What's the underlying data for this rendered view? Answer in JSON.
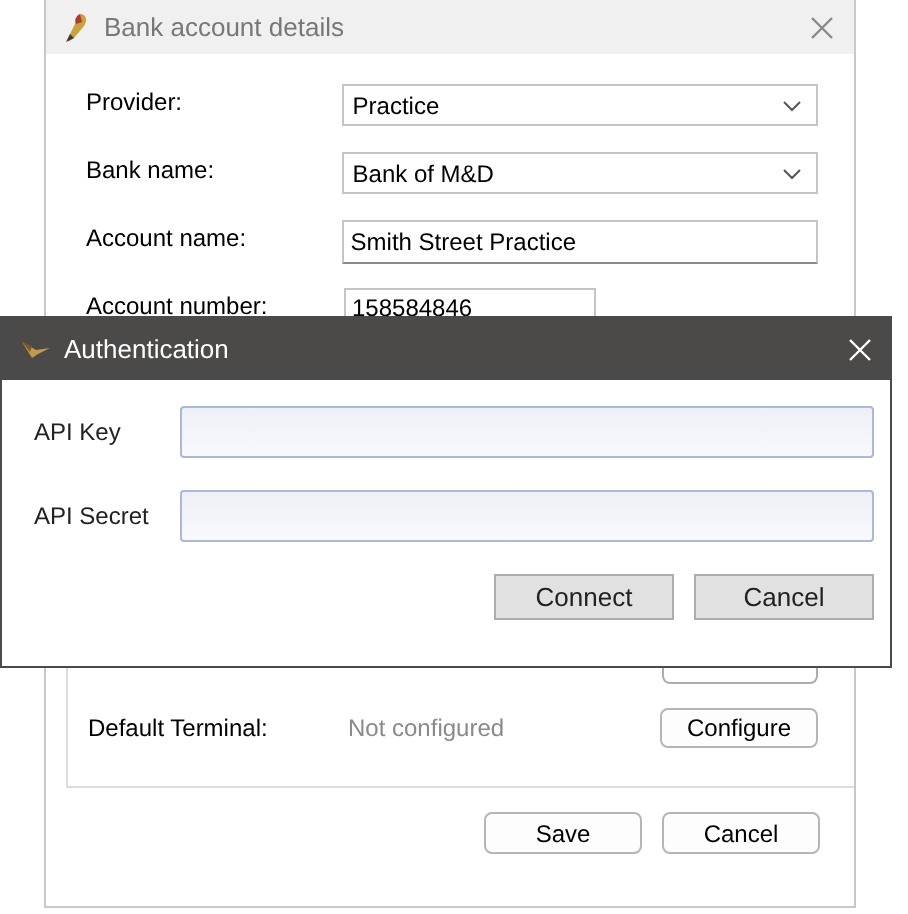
{
  "back_window": {
    "title": "Bank account details",
    "fields": [
      {
        "label": "Provider:",
        "value": "Practice",
        "kind": "dropdown"
      },
      {
        "label": "Bank name:",
        "value": "Bank of M&D",
        "kind": "dropdown"
      },
      {
        "label": "Account name:",
        "value": "Smith Street Practice",
        "kind": "text"
      },
      {
        "label": "Account number:",
        "value": "158584846",
        "kind": "short"
      }
    ],
    "terminal": {
      "label": "Default Terminal:",
      "value": "Not configured",
      "button": "Configure"
    },
    "buttons": [
      "Save",
      "Cancel"
    ]
  },
  "dialog": {
    "title": "Authentication",
    "fields": [
      {
        "label": "API Key"
      },
      {
        "label": "API Secret"
      }
    ],
    "buttons": [
      "Connect",
      "Cancel"
    ]
  }
}
